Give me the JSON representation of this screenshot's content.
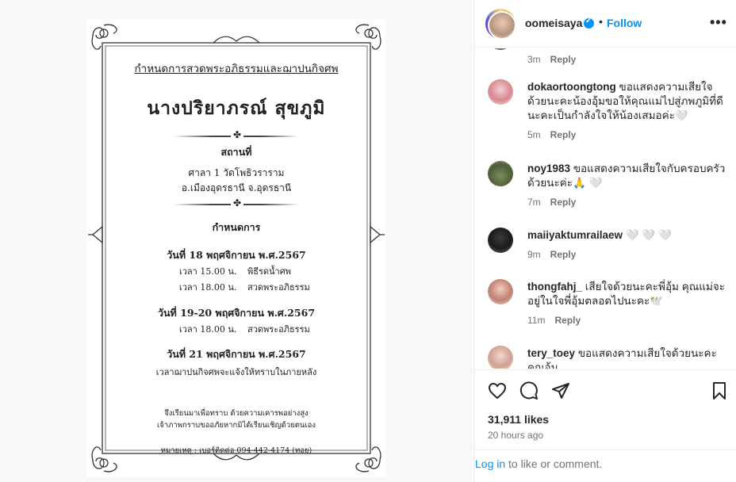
{
  "post": {
    "username": "oomeisaya",
    "dot": "•",
    "follow_label": "Follow",
    "more_icon": "more-horizontal-icon"
  },
  "invitation": {
    "heading": "กำหนดการสวดพระอภิธรรมและฌาปนกิจศพ",
    "name": "นางปริยาภรณ์   สุขภูมิ",
    "place_heading": "สถานที่",
    "place_line1": "ศาลา 1 วัดโพธิวราราม",
    "place_line2": "อ.เมืองอุดรธานี จ.อุดรธานี",
    "schedule_heading": "กำหนดการ",
    "day1": {
      "title": "วันที่ 18 พฤศจิกายน พ.ศ.2567",
      "rows": [
        {
          "time": "เวลา 15.00 น.",
          "event": "พิธีรดน้ำศพ"
        },
        {
          "time": "เวลา 18.00 น.",
          "event": "สวดพระอภิธรรม"
        }
      ]
    },
    "day2": {
      "title": "วันที่ 19-20 พฤศจิกายน พ.ศ.2567",
      "rows": [
        {
          "time": "เวลา 18.00 น.",
          "event": "สวดพระอภิธรรม"
        }
      ]
    },
    "day3": {
      "title": "วันที่ 21 พฤศจิกายน พ.ศ.2567",
      "note": "เวลาฌาปนกิจศพจะแจ้งให้ทราบในภายหลัง"
    },
    "footer1": "จึงเรียนมาเพื่อทราบ ด้วยความเคารพอย่างสูง",
    "footer2": "เจ้าภาพกราบขออภัยหากมิได้เรียนเชิญด้วยตนเอง",
    "footer3": "หมายเหตุ : เบอร์ติดต่อ 094-442-4174 (ทอย)"
  },
  "comments": [
    {
      "username": "",
      "text": "",
      "time": "3m",
      "reply": "Reply"
    },
    {
      "username": "dokaortoongtong",
      "text": "ขอแสดงความเสียใจด้วยนะคะน้องอุ้มขอให้คุณแม่ไปสู่ภพภูมิที่ดีนะคะเป็นกำลังใจให้น้องเสมอค่ะ🤍",
      "time": "5m",
      "reply": "Reply"
    },
    {
      "username": "noy1983",
      "text": "ขอแสดงความเสียใจกับครอบครัวด้วยนะค่ะ🙏 🤍",
      "time": "7m",
      "reply": "Reply"
    },
    {
      "username": "maiiyaktumrailaew",
      "text": "🤍 🤍 🤍",
      "time": "9m",
      "reply": "Reply"
    },
    {
      "username": "thongfahj_",
      "text": "เสียใจด้วยนะคะพี่อุ้ม คุณแม่จะอยู่ในใจพี่อุ้มตลอดไปนะคะ🕊️",
      "time": "11m",
      "reply": "Reply"
    },
    {
      "username": "tery_toey",
      "text": "ขอแสดงความเสียใจด้วยนะคะคุณอุ้ม",
      "time": "",
      "reply": ""
    }
  ],
  "stats": {
    "likes": "31,911 likes",
    "time_ago": "20 hours ago"
  },
  "login": {
    "link": "Log in",
    "rest": " to like or comment."
  },
  "colors": {
    "accent": "#0095f6",
    "muted": "#737373",
    "text": "#262626"
  }
}
